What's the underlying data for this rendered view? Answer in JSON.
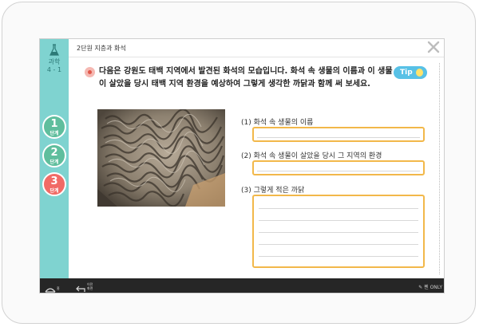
{
  "sidebar": {
    "subject": "과학",
    "grade": "4 - 1",
    "steps": [
      {
        "num": "1",
        "label": "단계",
        "color": "#5fbe9d"
      },
      {
        "num": "2",
        "label": "단계",
        "color": "#5fbe9d"
      },
      {
        "num": "3",
        "label": "단계",
        "color": "#f16b66"
      }
    ]
  },
  "header": {
    "unit_title": "2단원 지층과 화석"
  },
  "question": {
    "text": "다음은 강원도 태백 지역에서 발견된 화석의 모습입니다. 화석 속 생물의 이름과 이 생물이 살았을 당시 태백 지역 환경을 예상하여 그렇게 생각한 까닭과 함께 써 보세요.",
    "tip_label": "Tip"
  },
  "items": [
    {
      "label": "(1) 화석 속 생물의 이름"
    },
    {
      "label": "(2) 화석 속 생물이 살았을 당시 그 지역의 환경"
    },
    {
      "label": "(3) 그렇게 적은 까닭"
    }
  ],
  "bottom_bar": {
    "home_label": "홈",
    "back_label": "이전 화면",
    "pen_label": "펜 ONLY"
  },
  "colors": {
    "sidebar_bg": "#7fd3d0",
    "answer_border": "#f2b84a",
    "tip_bg": "#58c1e6",
    "active_step": "#f16b66",
    "inactive_step": "#5fbe9d"
  },
  "icons": [
    "flask-icon",
    "close-icon",
    "question-bullet-icon",
    "lightbulb-icon",
    "home-icon",
    "back-icon",
    "pen-icon"
  ]
}
